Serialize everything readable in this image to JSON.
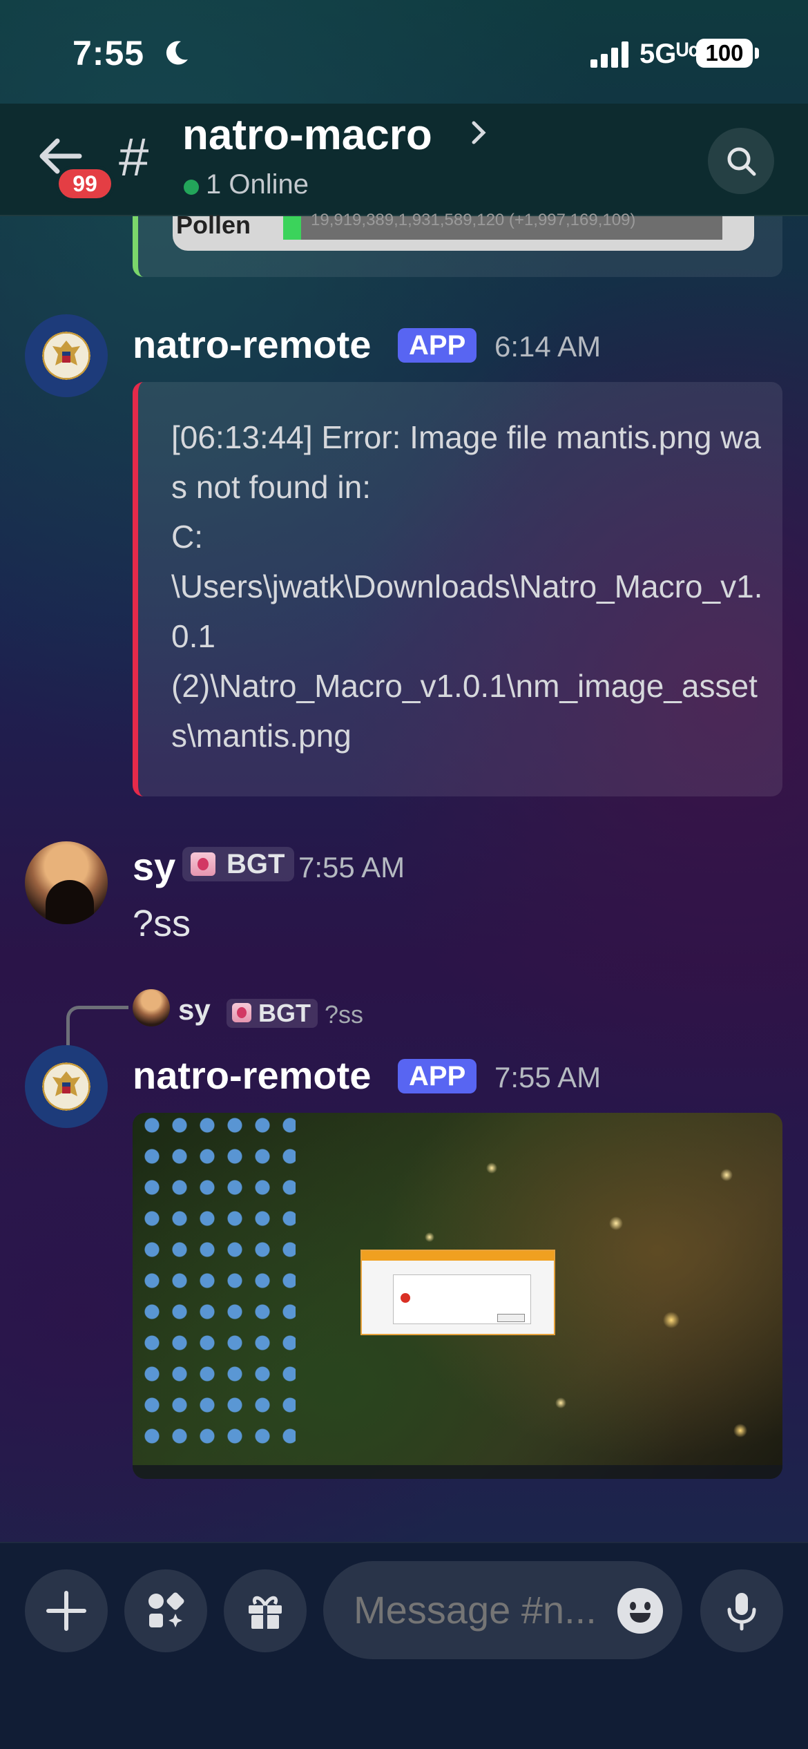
{
  "status_bar": {
    "time": "7:55",
    "network": "5Gᵁᶜ",
    "battery": "100"
  },
  "header": {
    "unread_count": "99",
    "channel_name": "natro-macro",
    "online_status": "1 Online"
  },
  "previous_embed": {
    "partial_label": "Pollen",
    "partial_value": "19,919,389,1,931,589,120 (+1,997,169,109)"
  },
  "messages": [
    {
      "author": "natro-remote",
      "tag": "APP",
      "time": "6:14 AM",
      "embed_text": "[06:13:44] Error: Image file mantis.png was not found in:\nC:\n\\Users\\jwatk\\Downloads\\Natro_Macro_v1.0.1\n(2)\\Natro_Macro_v1.0.1\\nm_image_assets\\mantis.png",
      "embed_color": "#e52a4a"
    },
    {
      "author": "sy",
      "role": "BGT",
      "time": "7:55 AM",
      "content": "?ss"
    },
    {
      "author": "natro-remote",
      "tag": "APP",
      "time": "7:55 AM",
      "reply": {
        "author": "sy",
        "role": "BGT",
        "content": "?ss"
      },
      "attachment": "desktop-screenshot"
    }
  ],
  "composer": {
    "placeholder": "Message #n..."
  },
  "colors": {
    "app_tag": "#5865f2",
    "online": "#23a55a",
    "badge": "#e43e44"
  }
}
